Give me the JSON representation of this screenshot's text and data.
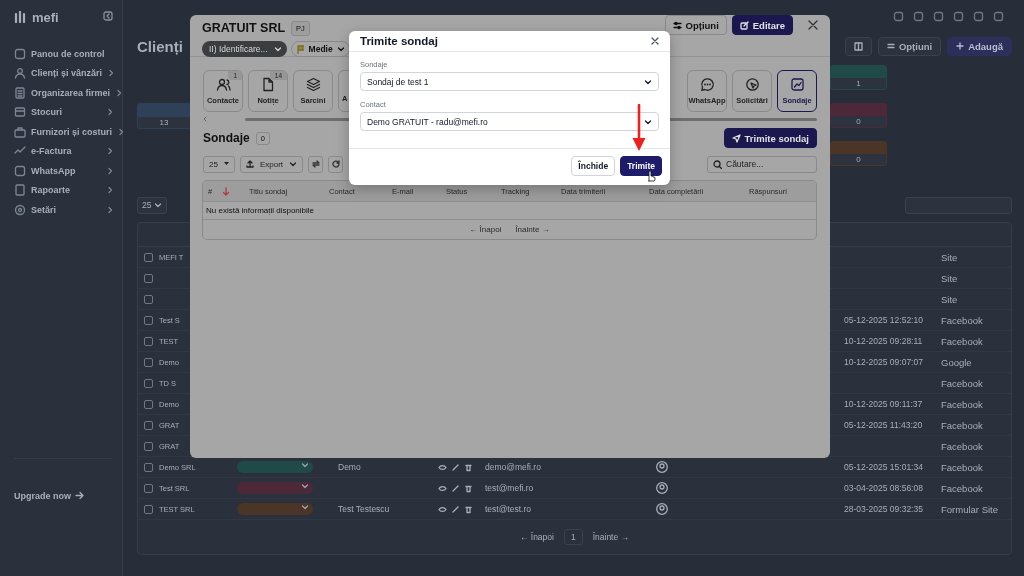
{
  "sidebar": {
    "logo": "mefi",
    "items": [
      {
        "label": "Panou de control",
        "expandable": false
      },
      {
        "label": "Clienți și vânzări",
        "expandable": true
      },
      {
        "label": "Organizarea firmei",
        "expandable": true
      },
      {
        "label": "Stocuri",
        "expandable": true
      },
      {
        "label": "Furnizori și costuri",
        "expandable": true
      },
      {
        "label": "e-Factura",
        "expandable": true
      },
      {
        "label": "WhatsApp",
        "expandable": true
      },
      {
        "label": "Rapoarte",
        "expandable": true
      },
      {
        "label": "Setări",
        "expandable": true
      }
    ],
    "upgrade": "Upgrade now"
  },
  "page": {
    "title": "Clienți",
    "buttons": [
      {
        "label": "Opțiuni",
        "kind": "secondary"
      },
      {
        "label": "Adaugă",
        "kind": "primary"
      }
    ],
    "stats": [
      {
        "value": "13",
        "color": "#2f4159"
      },
      {
        "value": "1",
        "color": "#1f4a47"
      },
      {
        "value": "0",
        "color": "#4d2838"
      },
      {
        "value": "0",
        "color": "#4a3526"
      }
    ],
    "page_size": "25",
    "rows": [
      {
        "name": "MEFI T",
        "checked": false,
        "source": "Site"
      },
      {
        "checked": false,
        "source": "Site"
      },
      {
        "checked": false,
        "source": "Site"
      },
      {
        "name": "Test S",
        "checked": false,
        "date": "05-12-2025 12:52:10",
        "source": "Facebook"
      },
      {
        "name": "TEST",
        "checked": false,
        "date": "10-12-2025 09:28:11",
        "source": "Facebook"
      },
      {
        "name": "Demo",
        "checked": false,
        "date": "10-12-2025 09:07:07",
        "source": "Google"
      },
      {
        "name": "TD S",
        "checked": false,
        "source": "Facebook"
      },
      {
        "name": "Demo",
        "checked": false,
        "date": "10-12-2025 09:11:37",
        "source": "Facebook"
      },
      {
        "name": "GRAT",
        "checked": false,
        "date": "05-12-2025 11:43:20",
        "source": "Facebook"
      },
      {
        "name": "GRAT",
        "checked": false,
        "source": "Facebook"
      },
      {
        "name": "Demo SRL",
        "checked": false,
        "color": "#1f4a47",
        "contact": "Demo",
        "email": "demo@mefi.ro",
        "date": "05-12-2025 15:01:34",
        "source": "Facebook"
      },
      {
        "name": "Test SRL",
        "checked": false,
        "color": "#4d2838",
        "email": "test@mefi.ro",
        "date": "03-04-2025 08:56:08",
        "source": "Facebook"
      },
      {
        "name": "TEST SRL",
        "checked": false,
        "color": "#4a3526",
        "contact": "Test Testescu",
        "email": "test@test.ro",
        "date": "28-03-2025 09:32:35",
        "source": "Formular Site"
      }
    ],
    "pagination": {
      "prev": "← Înapoi",
      "page": "1",
      "next": "Înainte →"
    }
  },
  "panel": {
    "title": "GRATUIT SRL",
    "badge": "PJ",
    "stage": "II) Identificare...",
    "priority": "Medie",
    "buttons": [
      {
        "label": "Opțiuni",
        "kind": "secondary"
      },
      {
        "label": "Editare",
        "kind": "primary"
      }
    ],
    "tabs": [
      {
        "label": "Contacte",
        "count": "1",
        "selected": false
      },
      {
        "label": "Notițe",
        "count": "14",
        "selected": false
      },
      {
        "label": "Sarcini",
        "selected": false
      },
      {
        "label": "A",
        "selected": false
      },
      {
        "label": "WhatsApp",
        "selected": false
      },
      {
        "label": "Solicitări",
        "selected": false
      },
      {
        "label": "Sondaje",
        "selected": true
      }
    ],
    "section": {
      "title": "Sondaje",
      "count": "0",
      "action": "Trimite sondaj"
    },
    "toolbar": {
      "page_size": "25",
      "export": "Export",
      "search_placeholder": "Căutare..."
    },
    "table": {
      "columns": [
        "#",
        "Titlu sondaj",
        "Contact",
        "E-mail",
        "Status",
        "Tracking",
        "Data trimiterii",
        "Data completării",
        "Răspunsuri"
      ],
      "empty": "Nu există informații disponibile",
      "prev": "← Înapoi",
      "next": "Înainte →"
    }
  },
  "dialog": {
    "title": "Trimite sondaj",
    "fields": [
      {
        "label": "Sondaje",
        "value": "Sondaj de test 1"
      },
      {
        "label": "Contact",
        "value": "Demo GRATUIT - radu@mefi.ro"
      }
    ],
    "buttons": [
      {
        "label": "Închide",
        "kind": "secondary"
      },
      {
        "label": "Trimite",
        "kind": "primary"
      }
    ]
  }
}
